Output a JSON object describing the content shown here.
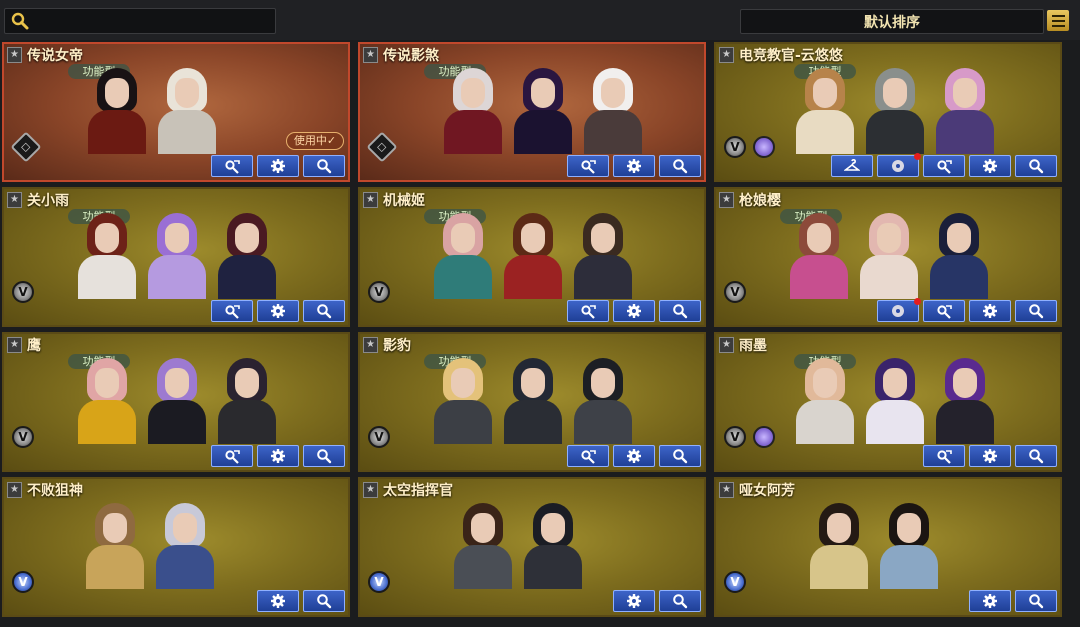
{
  "search": {
    "placeholder": "",
    "value": ""
  },
  "sort": {
    "label": "默认排序"
  },
  "cards": [
    {
      "name": "传说女帝",
      "tag": "功能型",
      "badges": [
        "legend"
      ],
      "in_use": "使用中✓",
      "buttons": [
        "skin-tool-icon",
        "gear-icon",
        "search-icon"
      ],
      "skins": [
        {
          "hair": "#181214",
          "body": "#6b1a12"
        },
        {
          "hair": "#e9e3d8",
          "body": "#c8c2b8"
        }
      ]
    },
    {
      "name": "传说影煞",
      "tag": "功能型",
      "badges": [
        "legend"
      ],
      "buttons": [
        "skin-tool-icon",
        "gear-icon",
        "search-icon"
      ],
      "skins": [
        {
          "hair": "#ddd6d6",
          "body": "#701722"
        },
        {
          "hair": "#2a1640",
          "body": "#1b1230"
        },
        {
          "hair": "#f1efee",
          "body": "#4a3b3a"
        }
      ]
    },
    {
      "name": "电竞教官-云悠悠",
      "tag": "功能型",
      "badges": [
        "v",
        "purple"
      ],
      "buttons": [
        "hanger-icon",
        "disc-icon",
        "skin-tool-icon",
        "gear-icon",
        "search-icon"
      ],
      "dot_on": 1,
      "skins": [
        {
          "hair": "#b7834a",
          "body": "#e8dbc2"
        },
        {
          "hair": "#8a8f8c",
          "body": "#2c2f33"
        },
        {
          "hair": "#d79ac8",
          "body": "#4b3a78"
        }
      ]
    },
    {
      "name": "关小雨",
      "tag": "功能型",
      "badges": [
        "v"
      ],
      "buttons": [
        "skin-tool-icon",
        "gear-icon",
        "search-icon"
      ],
      "skins": [
        {
          "hair": "#6d2218",
          "body": "#e6e1dc"
        },
        {
          "hair": "#9a6fd4",
          "body": "#b59ae0"
        },
        {
          "hair": "#4a1a22",
          "body": "#1f2240"
        }
      ]
    },
    {
      "name": "机械姬",
      "tag": "功能型",
      "badges": [
        "v"
      ],
      "buttons": [
        "skin-tool-icon",
        "gear-icon",
        "search-icon"
      ],
      "skins": [
        {
          "hair": "#d9a3a3",
          "body": "#2f7c79"
        },
        {
          "hair": "#5c2a16",
          "body": "#9b2222"
        },
        {
          "hair": "#3a2a20",
          "body": "#2d2d3a"
        }
      ]
    },
    {
      "name": "枪娘樱",
      "tag": "功能型",
      "badges": [
        "v"
      ],
      "buttons": [
        "disc-icon",
        "skin-tool-icon",
        "gear-icon",
        "search-icon"
      ],
      "dot_on": 0,
      "skins": [
        {
          "hair": "#8c4a3a",
          "body": "#c74f8f"
        },
        {
          "hair": "#e2b7b0",
          "body": "#e9d9cf"
        },
        {
          "hair": "#1a1f3a",
          "body": "#273566"
        }
      ]
    },
    {
      "name": "鹰",
      "tag": "功能型",
      "badges": [
        "v"
      ],
      "buttons": [
        "skin-tool-icon",
        "gear-icon",
        "search-icon"
      ],
      "skins": [
        {
          "hair": "#e0a5a5",
          "body": "#d8a418"
        },
        {
          "hair": "#9d7ad0",
          "body": "#1b1b22"
        },
        {
          "hair": "#2a2230",
          "body": "#2a2a2e"
        }
      ]
    },
    {
      "name": "影豹",
      "tag": "功能型",
      "badges": [
        "v"
      ],
      "buttons": [
        "skin-tool-icon",
        "gear-icon",
        "search-icon"
      ],
      "skins": [
        {
          "hair": "#e4c27a",
          "body": "#3c3f45"
        },
        {
          "hair": "#232834",
          "body": "#2a2d34"
        },
        {
          "hair": "#1c1f24",
          "body": "#3e4148"
        }
      ]
    },
    {
      "name": "雨墨",
      "tag": "功能型",
      "badges": [
        "v",
        "purple"
      ],
      "buttons": [
        "skin-tool-icon",
        "gear-icon",
        "search-icon"
      ],
      "skins": [
        {
          "hair": "#e1b99a",
          "body": "#d9d4ce"
        },
        {
          "hair": "#3a246b",
          "body": "#e8e4ef"
        },
        {
          "hair": "#5a2a8f",
          "body": "#24222c"
        }
      ]
    },
    {
      "name": "不败狙神",
      "tag": "",
      "badges": [
        "blue"
      ],
      "buttons": [
        "gear-icon",
        "search-icon"
      ],
      "skins": [
        {
          "hair": "#8f6a40",
          "body": "#c8a45a"
        },
        {
          "hair": "#c8c9d8",
          "body": "#3a4f8c"
        }
      ]
    },
    {
      "name": "太空指挥官",
      "tag": "",
      "badges": [
        "blue"
      ],
      "buttons": [
        "gear-icon",
        "search-icon"
      ],
      "skins": [
        {
          "hair": "#3a2418",
          "body": "#4a4e55"
        },
        {
          "hair": "#1b1d24",
          "body": "#2e3038"
        }
      ]
    },
    {
      "name": "哑女阿芳",
      "tag": "",
      "badges": [
        "blue"
      ],
      "buttons": [
        "gear-icon",
        "search-icon"
      ],
      "skins": [
        {
          "hair": "#241a14",
          "body": "#d7c58a"
        },
        {
          "hair": "#1b1512",
          "body": "#8aa7c4"
        }
      ]
    }
  ]
}
